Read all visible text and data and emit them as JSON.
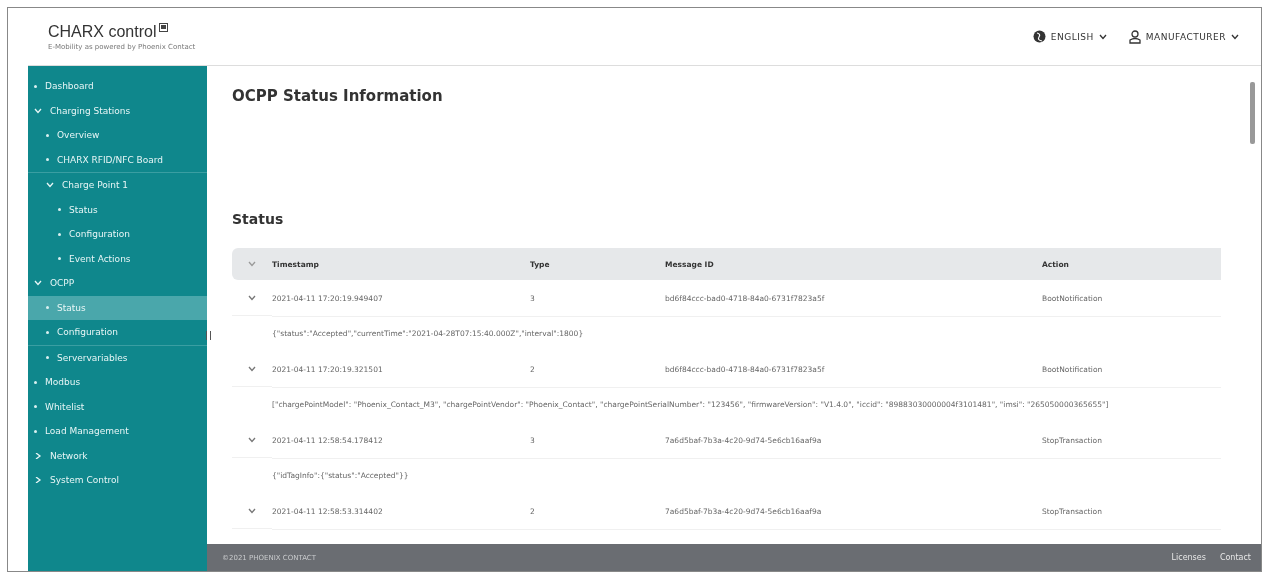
{
  "brand": {
    "name": "CHARX control",
    "tagline": "E-Mobility as powered by Phoenix Contact"
  },
  "header": {
    "language": "ENGLISH",
    "user": "MANUFACTURER"
  },
  "sidebar": {
    "items": [
      {
        "label": "Dashboard",
        "kind": "leaf",
        "selected": false
      },
      {
        "label": "Charging Stations",
        "kind": "group",
        "expanded": true,
        "selected": false,
        "children": [
          {
            "label": "Overview",
            "kind": "leaf",
            "selected": false
          },
          {
            "label": "CHARX RFID/NFC Board",
            "kind": "leaf",
            "selected": false
          },
          {
            "label": "Charge Point 1",
            "kind": "group",
            "expanded": true,
            "selected": false,
            "children": [
              {
                "label": "Status",
                "kind": "leaf",
                "selected": false
              },
              {
                "label": "Configuration",
                "kind": "leaf",
                "selected": false
              },
              {
                "label": "Event Actions",
                "kind": "leaf",
                "selected": false
              }
            ]
          }
        ]
      },
      {
        "label": "OCPP",
        "kind": "group",
        "expanded": true,
        "selected": false,
        "children": [
          {
            "label": "Status",
            "kind": "leaf",
            "selected": true
          },
          {
            "label": "Configuration",
            "kind": "leaf",
            "selected": false
          },
          {
            "label": "Servervariables",
            "kind": "leaf",
            "selected": false
          }
        ]
      },
      {
        "label": "Modbus",
        "kind": "leaf",
        "selected": false
      },
      {
        "label": "Whitelist",
        "kind": "leaf",
        "selected": false
      },
      {
        "label": "Load Management",
        "kind": "leaf",
        "selected": false
      },
      {
        "label": "Network",
        "kind": "group",
        "expanded": false,
        "selected": false
      },
      {
        "label": "System Control",
        "kind": "group",
        "expanded": false,
        "selected": false
      }
    ]
  },
  "page_title": "OCPP Status Information",
  "section_title": "Status",
  "table": {
    "columns": [
      "Timestamp",
      "Type",
      "Message ID",
      "Action"
    ],
    "rows": [
      {
        "cells": [
          "2021-04-11 17:20:19.949407",
          "3",
          "bd6f84ccc-bad0-4718-84a0-6731f7823a5f",
          "BootNotification"
        ],
        "detail": "{\"status\":\"Accepted\",\"currentTime\":\"2021-04-28T07:15:40.000Z\",\"interval\":1800}"
      },
      {
        "cells": [
          "2021-04-11 17:20:19.321501",
          "2",
          "bd6f84ccc-bad0-4718-84a0-6731f7823a5f",
          "BootNotification"
        ],
        "detail": "[\"chargePointModel\": \"Phoenix_Contact_M3\", \"chargePointVendor\": \"Phoenix_Contact\", \"chargePointSerialNumber\": \"123456\", \"firmwareVersion\": \"V1.4.0\", \"iccid\": \"89883030000004f3101481\", \"imsi\": \"265050000365655\"]"
      },
      {
        "cells": [
          "2021-04-11 12:58:54.178412",
          "3",
          "7a6d5baf-7b3a-4c20-9d74-5e6cb16aaf9a",
          "StopTransaction"
        ],
        "detail": "{\"idTagInfo\":{\"status\":\"Accepted\"}}"
      },
      {
        "cells": [
          "2021-04-11 12:58:53.314402",
          "2",
          "7a6d5baf-7b3a-4c20-9d74-5e6cb16aaf9a",
          "StopTransaction"
        ]
      }
    ]
  },
  "footer": {
    "copyright": "©2021 PHOENIX CONTACT",
    "links": [
      "Licenses",
      "Contact"
    ]
  }
}
